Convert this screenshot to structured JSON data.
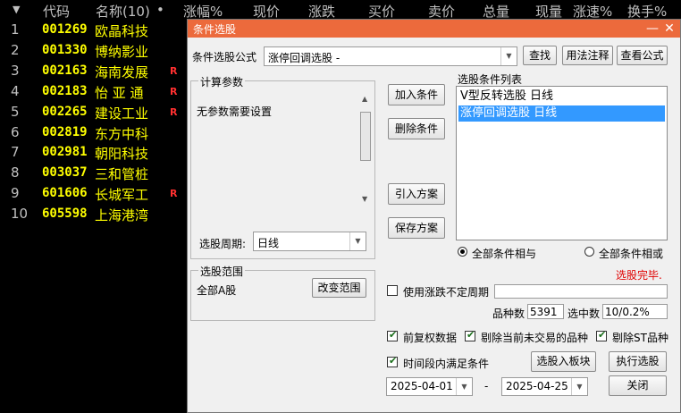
{
  "table": {
    "headers": [
      "代码",
      "名称(10)",
      "•",
      "涨幅%",
      "现价",
      "涨跌",
      "买价",
      "卖价",
      "总量",
      "现量",
      "涨速%",
      "换手%"
    ],
    "rows": [
      {
        "idx": "1",
        "code": "001269",
        "name": "欧晶科技",
        "flag": ""
      },
      {
        "idx": "2",
        "code": "001330",
        "name": "博纳影业",
        "flag": ""
      },
      {
        "idx": "3",
        "code": "002163",
        "name": "海南发展",
        "flag": "R"
      },
      {
        "idx": "4",
        "code": "002183",
        "name": "怡 亚 通",
        "flag": "R"
      },
      {
        "idx": "5",
        "code": "002265",
        "name": "建设工业",
        "flag": "R"
      },
      {
        "idx": "6",
        "code": "002819",
        "name": "东方中科",
        "flag": ""
      },
      {
        "idx": "7",
        "code": "002981",
        "name": "朝阳科技",
        "flag": ""
      },
      {
        "idx": "8",
        "code": "003037",
        "name": "三和管桩",
        "flag": ""
      },
      {
        "idx": "9",
        "code": "601606",
        "name": "长城军工",
        "flag": "R"
      },
      {
        "idx": "10",
        "code": "605598",
        "name": "上海港湾",
        "flag": ""
      }
    ]
  },
  "dialog": {
    "title": "条件选股",
    "formula_label": "条件选股公式",
    "formula_value": "涨停回调选股 -",
    "find_btn": "查找",
    "usage_btn": "用法注释",
    "view_btn": "查看公式",
    "params_group": "计算参数",
    "params_text": "无参数需要设置",
    "period_label": "选股周期:",
    "period_value": "日线",
    "add_btn": "加入条件",
    "del_btn": "删除条件",
    "import_btn": "引入方案",
    "save_btn": "保存方案",
    "cond_list_label": "选股条件列表",
    "conditions": [
      "V型反转选股  日线",
      "涨停回调选股  日线"
    ],
    "radio_and": "全部条件相与",
    "radio_or": "全部条件相或",
    "status": "选股完毕.",
    "status_color": "#e00000",
    "scope_group": "选股范围",
    "scope_value": "全部A股",
    "scope_btn": "改变范围",
    "use_period_label": "使用涨跌不定周期",
    "count_label": "品种数",
    "count_value": "5391",
    "selected_label": "选中数",
    "selected_value": "10/0.2%",
    "chk_adjust": "前复权数据",
    "chk_notrade": "剔除当前未交易的品种",
    "chk_st": "剔除ST品种",
    "chk_period": "时间段内满足条件",
    "to_board_btn": "选股入板块",
    "exec_btn": "执行选股",
    "date_from": "2025-04-01",
    "date_sep": "-",
    "date_to": "2025-04-25",
    "close_btn": "关闭",
    "title_color": "#ec6a3c"
  }
}
